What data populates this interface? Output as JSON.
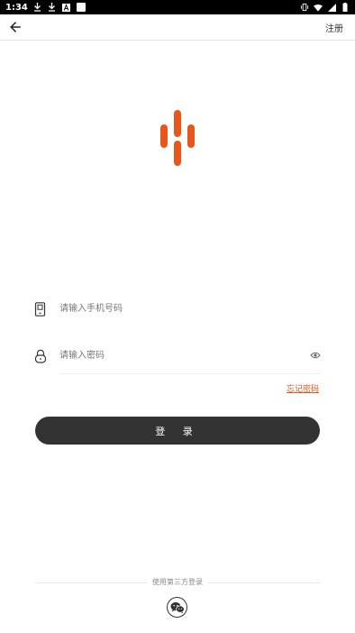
{
  "status_bar": {
    "time": "1:34",
    "left_icons": [
      "download-icon",
      "download-icon",
      "a-icon",
      "square-icon"
    ],
    "right_icons": [
      "vibrate-icon",
      "wifi-icon",
      "signal-icon",
      "battery-icon"
    ]
  },
  "nav": {
    "back_icon": "arrow-left-icon",
    "register_label": "注册"
  },
  "logo": {
    "color": "#e8561e"
  },
  "form": {
    "phone_placeholder": "请输入手机号码",
    "phone_value": "",
    "password_placeholder": "请输入密码",
    "password_value": "",
    "forgot_label": "忘记密码",
    "login_label": "登 录"
  },
  "third_party": {
    "label": "使用第三方登录",
    "wechat_icon": "wechat-icon"
  },
  "colors": {
    "accent": "#e8561e",
    "button_bg": "#333333",
    "link": "#e0531c"
  }
}
